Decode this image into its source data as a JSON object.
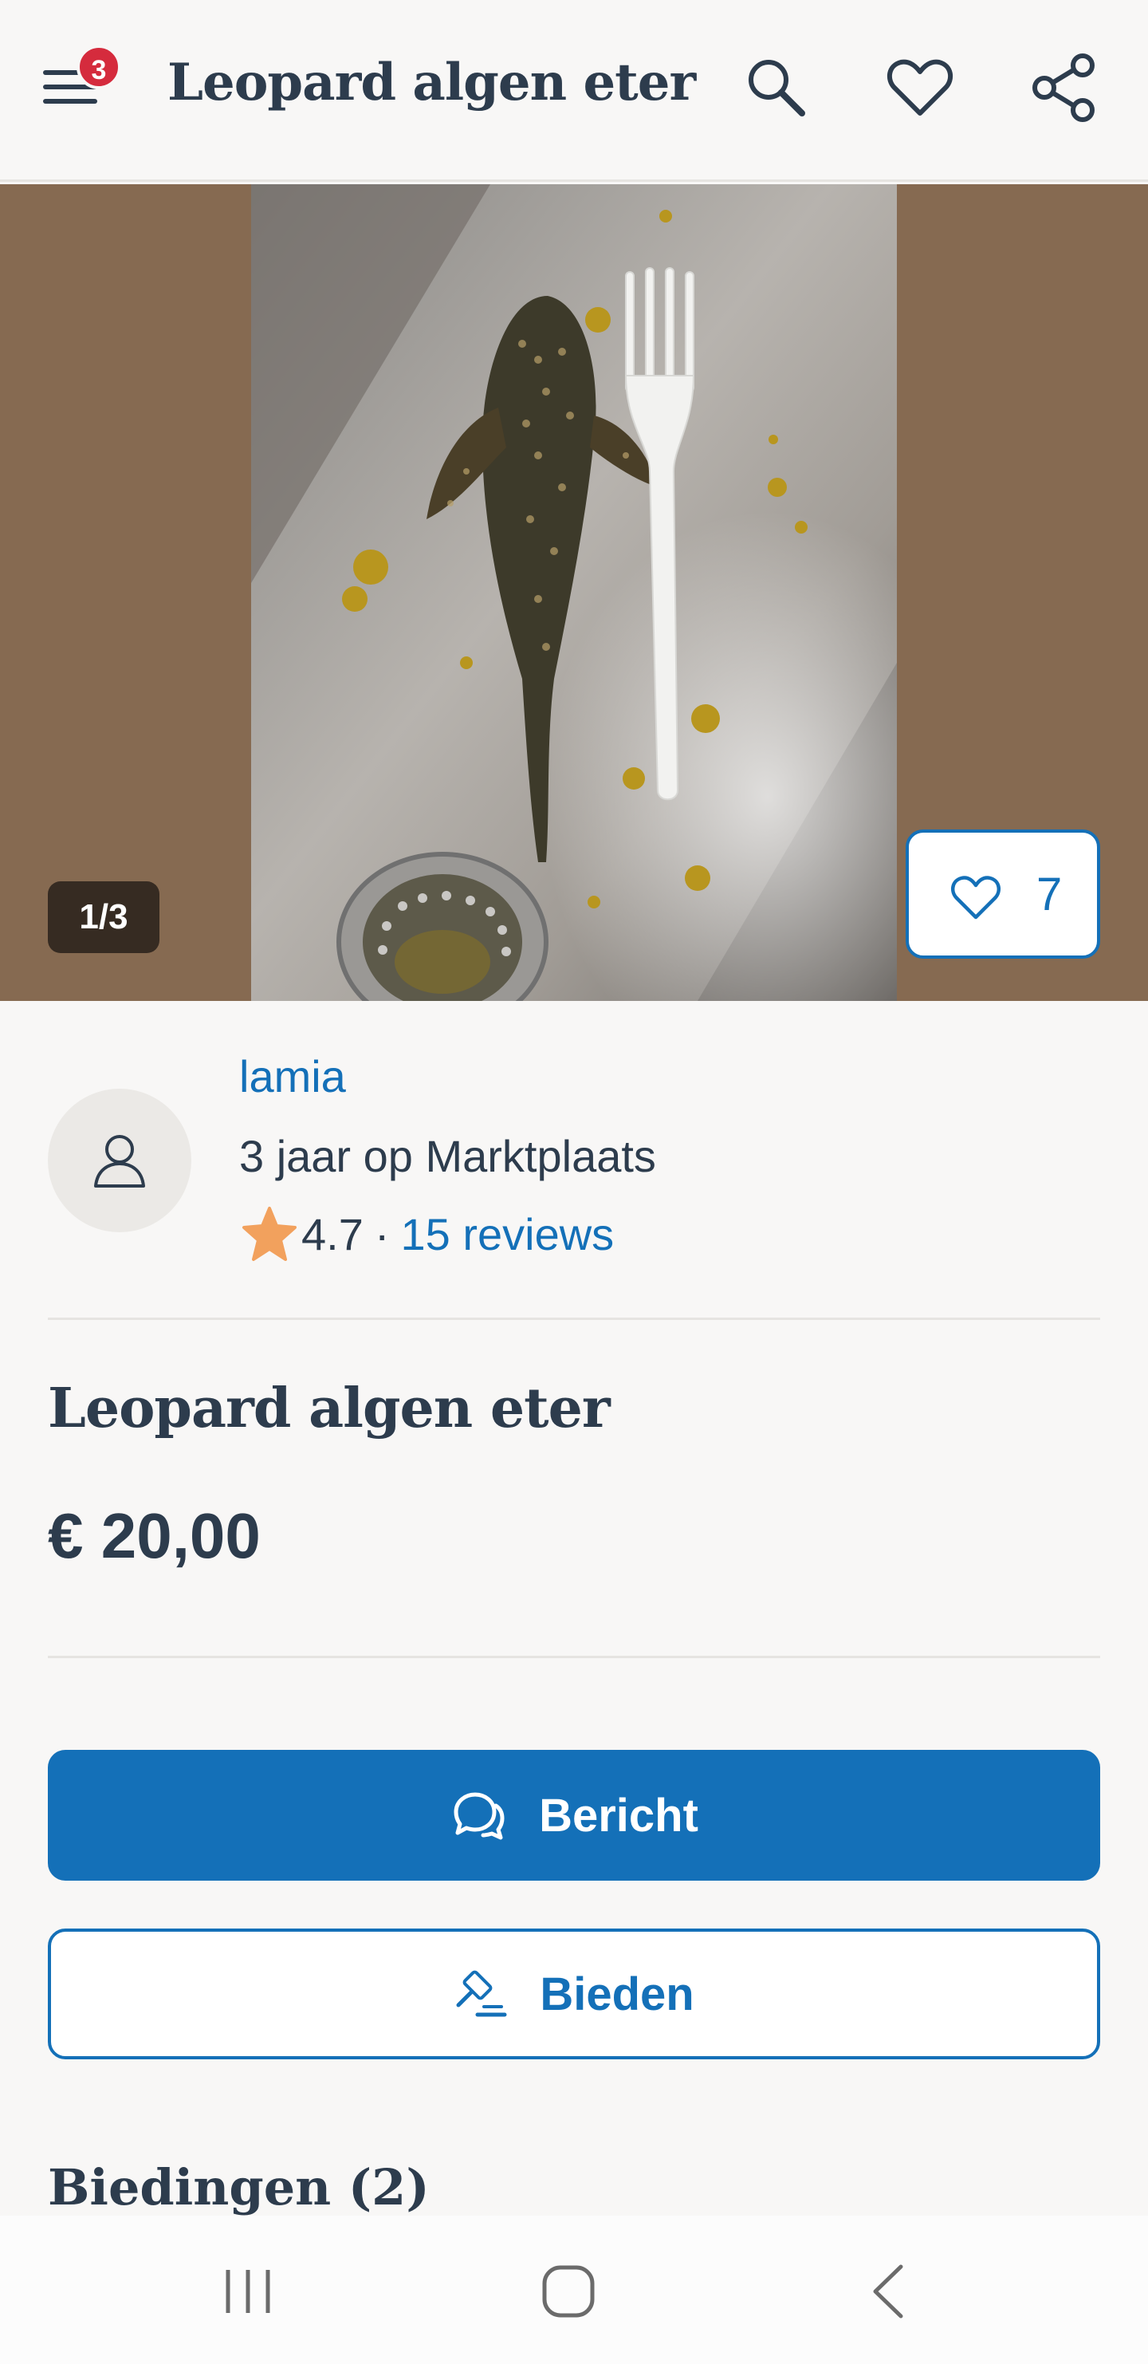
{
  "header": {
    "menu_badge": "3",
    "title": "Leopard algen eter",
    "icons": [
      "menu-icon",
      "search-icon",
      "heart-icon",
      "share-icon"
    ]
  },
  "gallery": {
    "counter": "1/3",
    "favorites_count": "7"
  },
  "seller": {
    "name": "lamia",
    "since": "3 jaar op Marktplaats",
    "rating": "4.7",
    "separator": "·",
    "reviews": "15 reviews"
  },
  "listing": {
    "title": "Leopard algen eter",
    "price": "€ 20,00"
  },
  "actions": {
    "message_label": "Bericht",
    "bid_label": "Bieden"
  },
  "bids": {
    "heading": "Biedingen (2)"
  },
  "colors": {
    "accent": "#1470b8",
    "badge": "#d52b3d",
    "star": "#f2a15d",
    "text": "#2d3c4d",
    "gallery_bg": "#866a51"
  }
}
